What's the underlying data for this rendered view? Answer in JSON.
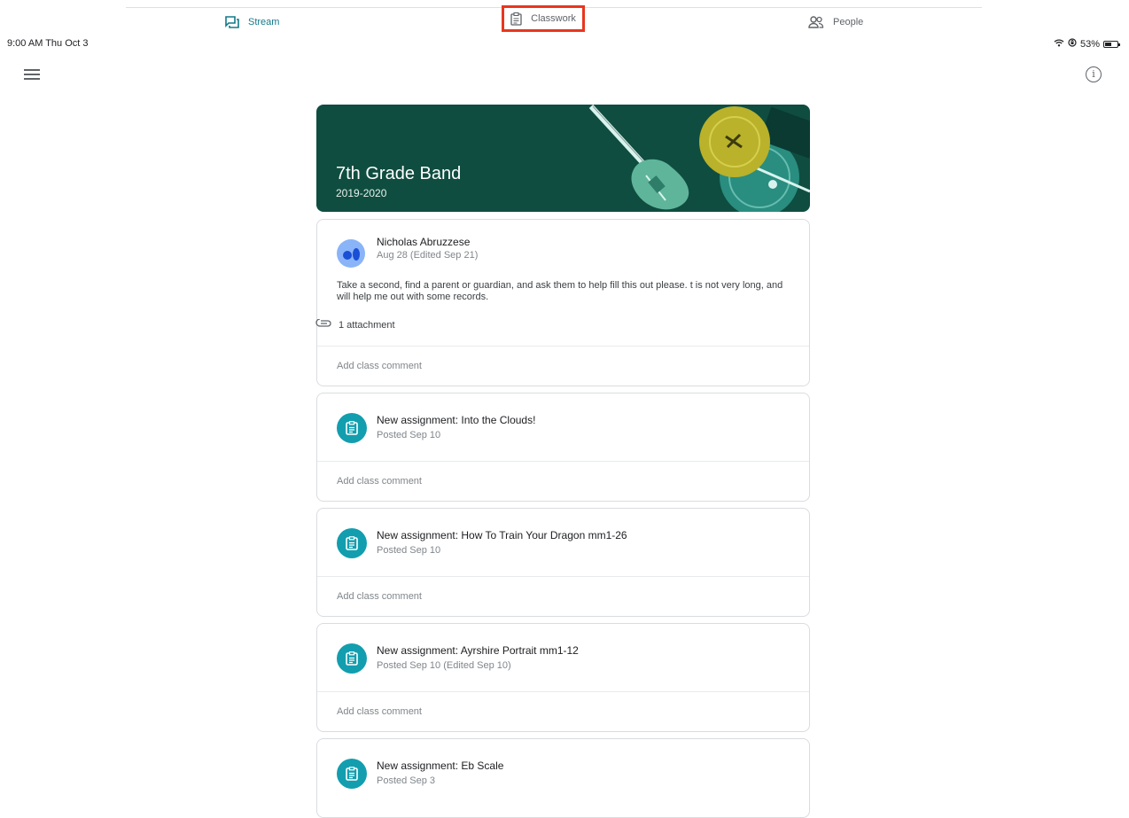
{
  "tabs": [
    {
      "label": "Stream",
      "icon": "stream-icon"
    },
    {
      "label": "Classwork",
      "icon": "classwork-icon"
    },
    {
      "label": "People",
      "icon": "people-icon"
    }
  ],
  "status_bar": {
    "time": "9:00 AM  Thu Oct 3",
    "battery_text": "53%",
    "battery_level": 0.53
  },
  "banner": {
    "title": "7th Grade Band",
    "subtitle": "2019-2020",
    "color": "#0f4d40"
  },
  "announcement": {
    "author": "Nicholas Abruzzese",
    "date": "Aug 28 (Edited Sep 21)",
    "body": "Take a second, find a parent or guardian, and ask them to help fill this out please. t is not very long, and will help me out with some records.",
    "attachment": "1 attachment",
    "comment_placeholder": "Add class comment"
  },
  "assignments": [
    {
      "title": "New assignment: Into the Clouds!",
      "date": "Posted Sep 10",
      "comment_placeholder": "Add class comment"
    },
    {
      "title": "New assignment: How To Train Your Dragon mm1-26",
      "date": "Posted Sep 10",
      "comment_placeholder": "Add class comment"
    },
    {
      "title": "New assignment: Ayrshire Portrait mm1-12",
      "date": "Posted Sep 10 (Edited Sep 10)",
      "comment_placeholder": "Add class comment"
    },
    {
      "title": "New assignment: Eb Scale",
      "date": "Posted Sep 3"
    }
  ],
  "colors": {
    "accent": "#137a8a",
    "highlight": "#e8361e",
    "assignment_icon": "#129eaf"
  }
}
